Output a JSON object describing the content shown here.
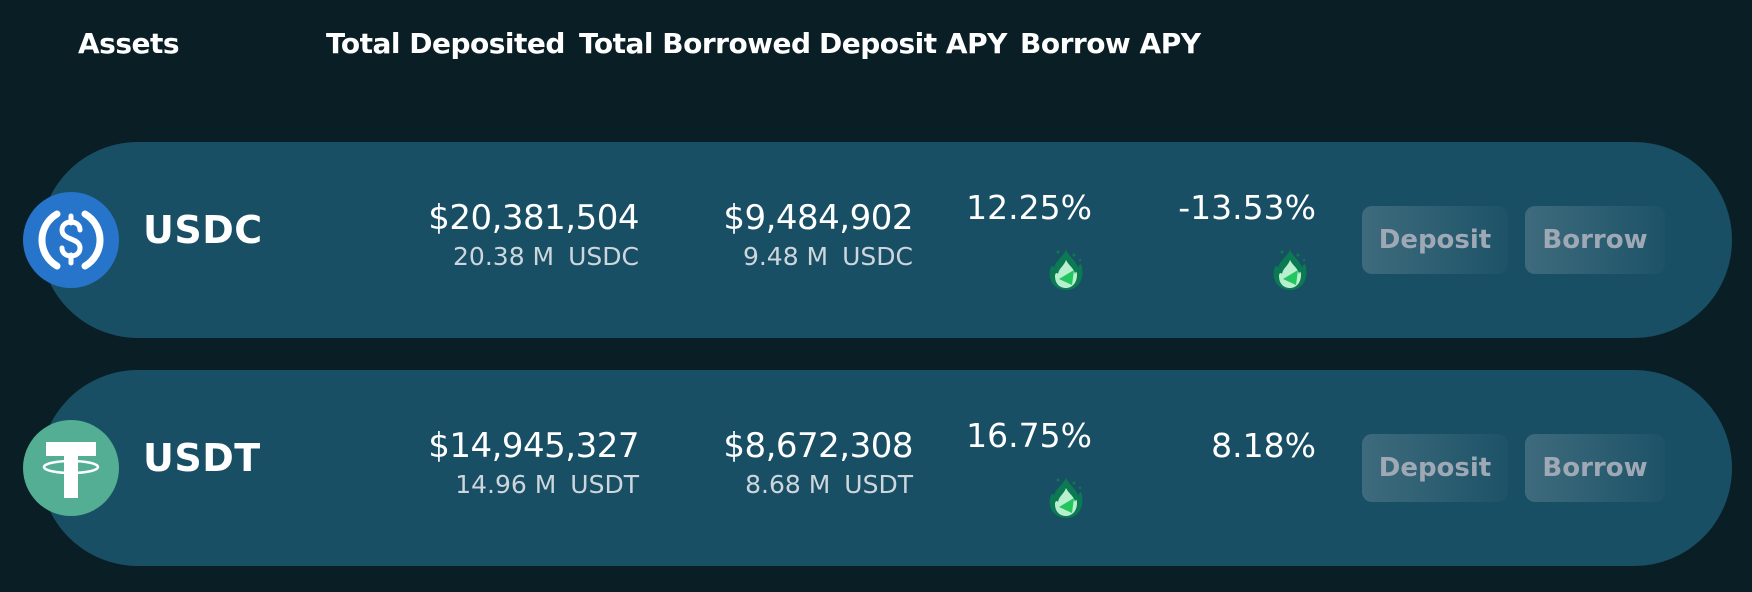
{
  "header": {
    "assets": "Assets",
    "total_deposited": "Total Deposited",
    "total_borrowed": "Total Borrowed",
    "deposit_apy": "Deposit APY",
    "borrow_apy": "Borrow APY"
  },
  "rows": [
    {
      "symbol": "USDC",
      "icon": "usdc-logo-icon",
      "icon_color": "#2775ca",
      "deposited_usd": "$20,381,504",
      "deposited_amount": "20.38 M",
      "deposited_unit": "USDC",
      "borrowed_usd": "$9,484,902",
      "borrowed_amount": "9.48 M",
      "borrowed_unit": "USDC",
      "deposit_apy": "12.25%",
      "deposit_apy_boosted": true,
      "borrow_apy": "-13.53%",
      "borrow_apy_boosted": true,
      "deposit_button": "Deposit",
      "borrow_button": "Borrow"
    },
    {
      "symbol": "USDT",
      "icon": "usdt-logo-icon",
      "icon_color": "#53ae94",
      "deposited_usd": "$14,945,327",
      "deposited_amount": "14.96 M",
      "deposited_unit": "USDT",
      "borrowed_usd": "$8,672,308",
      "borrowed_amount": "8.68 M",
      "borrowed_unit": "USDT",
      "deposit_apy": "16.75%",
      "deposit_apy_boosted": true,
      "borrow_apy": "8.18%",
      "borrow_apy_boosted": false,
      "deposit_button": "Deposit",
      "borrow_button": "Borrow"
    }
  ],
  "colors": {
    "background": "#0a1f25",
    "row_background": "#194f64",
    "flame_dark": "#0b7a52",
    "flame_light": "#b8f0cf",
    "flame_accent": "#22c55e"
  }
}
